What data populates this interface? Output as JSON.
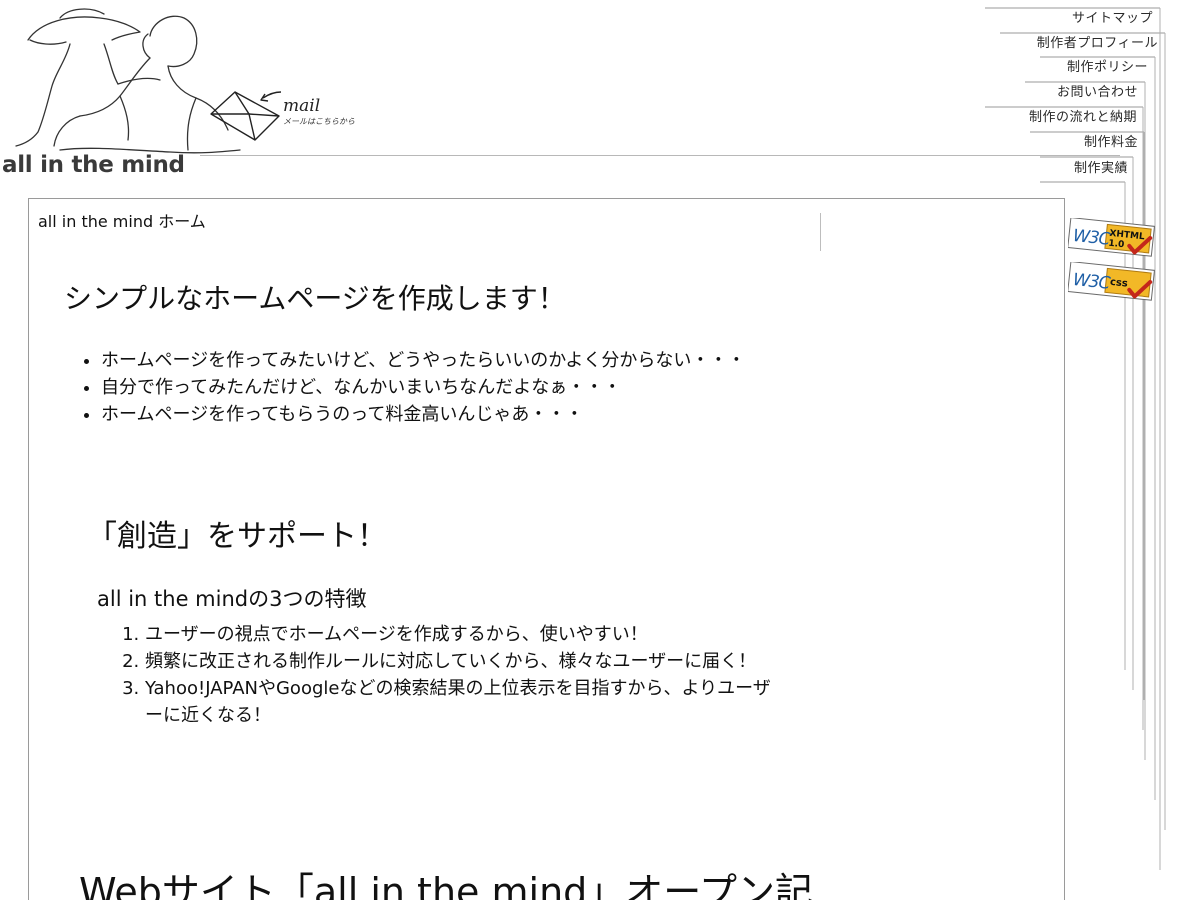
{
  "site": {
    "logo_text": "all in the mind",
    "mail_text": "mail",
    "mail_subtext": "メールはこちらから"
  },
  "nav": {
    "items": [
      {
        "id": "sitemap",
        "label": "サイトマップ"
      },
      {
        "id": "profile",
        "label": "制作者プロフィール"
      },
      {
        "id": "policy",
        "label": "制作ポリシー"
      },
      {
        "id": "contact",
        "label": "お問い合わせ"
      },
      {
        "id": "flow",
        "label": "制作の流れと納期"
      },
      {
        "id": "price",
        "label": "制作料金"
      },
      {
        "id": "works",
        "label": "制作実績"
      }
    ]
  },
  "badges": {
    "xhtml": {
      "left": "W3C",
      "top": "XHTML",
      "bottom": "1.0"
    },
    "css": {
      "left": "W3C",
      "top": "css"
    }
  },
  "content": {
    "breadcrumb": "all in the mind ホーム",
    "heading1": "シンプルなホームページを作成します！",
    "concerns": [
      "ホームページを作ってみたいけど、どうやったらいいのかよく分からない・・・",
      "自分で作ってみたんだけど、なんかいまいちなんだよなぁ・・・",
      "ホームページを作ってもらうのって料金高いんじゃあ・・・"
    ],
    "heading2": "「創造」をサポート！",
    "heading3": "all in the mindの3つの特徴",
    "features": [
      "ユーザーの視点でホームページを作成するから、使いやすい！",
      "頻繁に改正される制作ルールに対応していくから、様々なユーザーに届く！",
      "Yahoo!JAPANやGoogleなどの検索結果の上位表示を目指すから、よりユーザーに近くなる！"
    ],
    "heading4": "Webサイト「all in the mind」オープン記"
  }
}
